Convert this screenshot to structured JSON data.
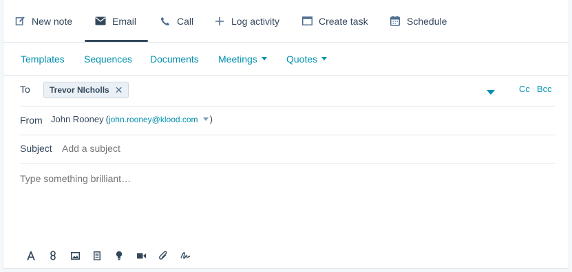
{
  "tabs": [
    {
      "label": "New note",
      "icon": "edit-icon"
    },
    {
      "label": "Email",
      "icon": "envelope-icon",
      "active": true
    },
    {
      "label": "Call",
      "icon": "phone-icon"
    },
    {
      "label": "Log activity",
      "icon": "plus-icon"
    },
    {
      "label": "Create task",
      "icon": "window-icon"
    },
    {
      "label": "Schedule",
      "icon": "calendar-icon"
    }
  ],
  "subnav": {
    "templates": "Templates",
    "sequences": "Sequences",
    "documents": "Documents",
    "meetings": "Meetings",
    "quotes": "Quotes"
  },
  "to": {
    "label": "To",
    "recipient": "Trevor NIcholls",
    "remove": "✕",
    "cc": "Cc",
    "bcc": "Bcc"
  },
  "from": {
    "label": "From",
    "name": "John Rooney",
    "paren_open": "(",
    "email": "john.rooney@klood.com",
    "paren_close": ")"
  },
  "subject": {
    "label": "Subject",
    "placeholder": "Add a subject"
  },
  "body": {
    "placeholder": "Type something brilliant…"
  },
  "toolbar": [
    "text-format-icon",
    "link-icon",
    "image-icon",
    "document-icon",
    "lightbulb-icon",
    "video-icon",
    "attachment-icon",
    "signature-icon"
  ],
  "colors": {
    "accent": "#0091ae",
    "text": "#33475b",
    "placeholder": "#7c98b6"
  }
}
